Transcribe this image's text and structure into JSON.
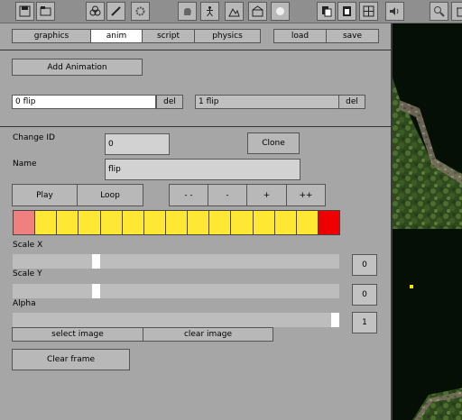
{
  "toolbar": {
    "icons": [
      "save-icon",
      "open-icon",
      "group-icon",
      "brush-icon",
      "gear-icon",
      "hand-icon",
      "figure-icon",
      "terrain-icon",
      "scene-icon",
      "light-icon",
      "copy-icon",
      "paste-icon",
      "grid-icon",
      "sound-icon",
      "zoom-icon",
      "delete-icon"
    ]
  },
  "tabs": [
    {
      "label": "graphics"
    },
    {
      "label": "anim",
      "active": true
    },
    {
      "label": "script"
    },
    {
      "label": "physics"
    }
  ],
  "file": {
    "load_label": "load",
    "save_label": "save"
  },
  "add_animation_label": "Add Animation",
  "animations": [
    {
      "name": "0 flip",
      "del_label": "del",
      "selected": true
    },
    {
      "name": "1 flip",
      "del_label": "del",
      "selected": false
    }
  ],
  "change_id": {
    "label": "Change ID",
    "value": "0"
  },
  "clone_label": "Clone",
  "name_field": {
    "label": "Name",
    "value": "flip"
  },
  "playback": {
    "play_label": "Play",
    "loop_label": "Loop",
    "speed_buttons": [
      "- -",
      "-",
      "+",
      "++"
    ]
  },
  "frame_strip": {
    "frame_states": [
      "start",
      "normal",
      "normal",
      "normal",
      "normal",
      "normal",
      "normal",
      "normal",
      "normal",
      "normal",
      "normal",
      "normal",
      "normal",
      "normal",
      "end"
    ],
    "colors": {
      "start": "#f08080",
      "normal": "#ffe833",
      "end": "#ee0000"
    }
  },
  "sliders": [
    {
      "label": "Scale X",
      "value": "0",
      "position": 0.25
    },
    {
      "label": "Scale Y",
      "value": "0",
      "position": 0.25
    },
    {
      "label": "Alpha",
      "value": "1",
      "position": 1.0
    }
  ],
  "image": {
    "select_label": "select image",
    "clear_label": "clear image"
  },
  "clear_frame_label": "Clear frame"
}
